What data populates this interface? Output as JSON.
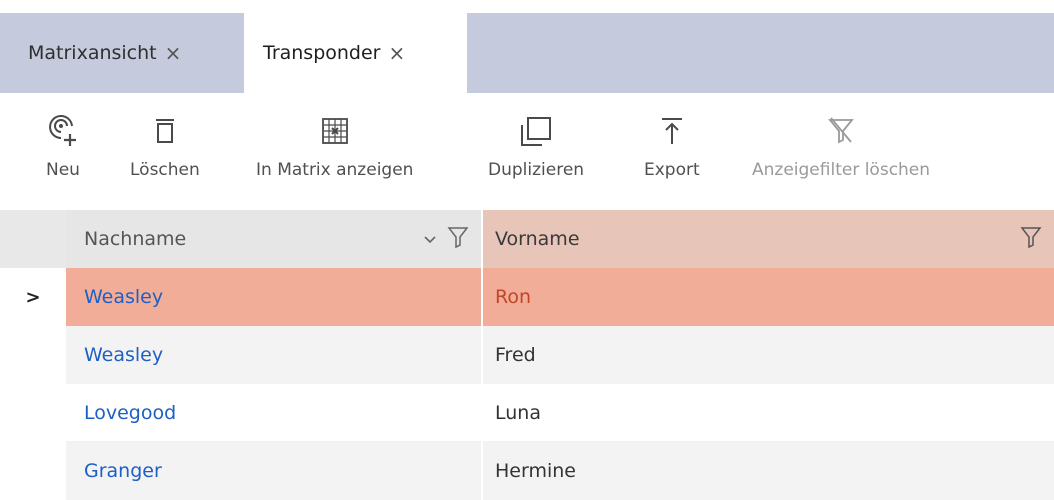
{
  "tabs": [
    {
      "label": "Matrixansicht",
      "close": "×"
    },
    {
      "label": "Transponder",
      "close": "×"
    }
  ],
  "toolbar": {
    "new_label": "Neu",
    "delete_label": "Löschen",
    "show_matrix_label": "In Matrix anzeigen",
    "duplicate_label": "Duplizieren",
    "export_label": "Export",
    "clear_filter_label": "Anzeigefilter löschen"
  },
  "grid": {
    "columns": [
      {
        "label": "Nachname"
      },
      {
        "label": "Vorname"
      }
    ],
    "current_row_marker": ">",
    "rows": [
      {
        "nachname": "Weasley",
        "vorname": "Ron"
      },
      {
        "nachname": "Weasley",
        "vorname": "Fred"
      },
      {
        "nachname": "Lovegood",
        "vorname": "Luna"
      },
      {
        "nachname": "Granger",
        "vorname": "Hermine"
      }
    ]
  },
  "colors": {
    "tab_strip": "#c5cbdc",
    "selected_row": "#f2ad98",
    "sorted_header": "#e8c5b9",
    "link": "#1e5fc4"
  }
}
